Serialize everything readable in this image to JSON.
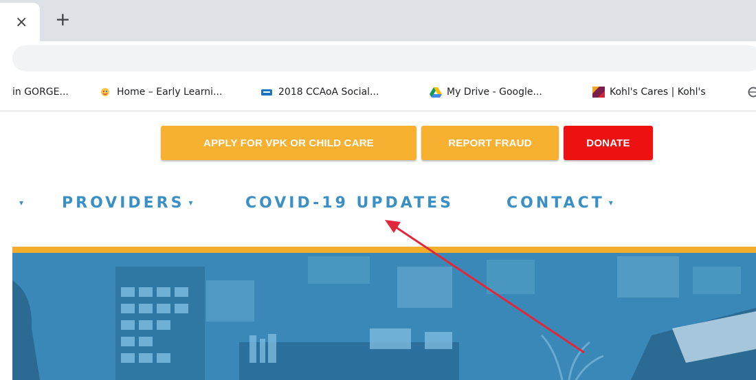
{
  "browser": {
    "tab_close_glyph": "×",
    "new_tab_glyph": "+",
    "bookmarks": [
      {
        "label": "in GORGE...",
        "icon": "none"
      },
      {
        "label": "Home – Early Learni...",
        "icon": "face-logo-icon"
      },
      {
        "label": "2018 CCAoA Social...",
        "icon": "apk-logo-icon"
      },
      {
        "label": "My Drive - Google...",
        "icon": "google-drive-icon"
      },
      {
        "label": "Kohl's Cares | Kohl's",
        "icon": "kohls-logo-icon"
      }
    ]
  },
  "site": {
    "top_buttons": [
      {
        "label": "APPLY FOR VPK OR CHILD CARE",
        "color": "#f7b030"
      },
      {
        "label": "REPORT FRAUD",
        "color": "#f7b030"
      },
      {
        "label": "DONATE",
        "color": "#ee1111"
      }
    ],
    "nav": [
      {
        "label": "PROVIDERS",
        "caret": "▾"
      },
      {
        "label": "COVID-19 UPDATES",
        "caret": ""
      },
      {
        "label": "CONTACT",
        "caret": "▾"
      }
    ],
    "nav_leading_caret": "▾",
    "nav_color": "#3a8fc4",
    "accent_rule_color": "#f2ad2a",
    "hero_tint": "#3f8fbf"
  },
  "annotation": {
    "arrow_color": "#e0283a"
  }
}
